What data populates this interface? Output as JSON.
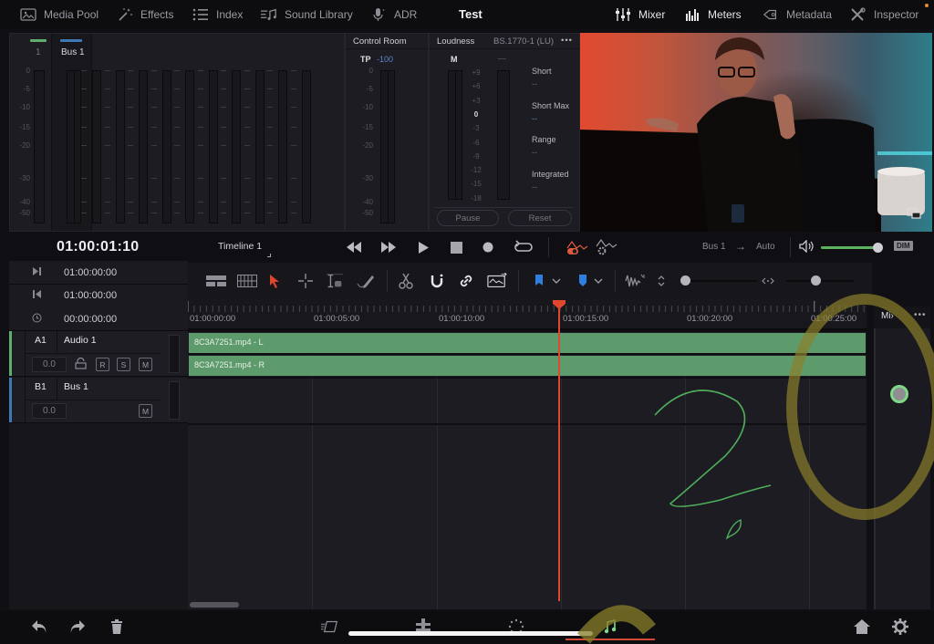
{
  "topbar": {
    "items_left": [
      {
        "icon": "media-pool-icon",
        "label": "Media Pool"
      },
      {
        "icon": "effects-icon",
        "label": "Effects"
      },
      {
        "icon": "index-icon",
        "label": "Index"
      },
      {
        "icon": "sound-library-icon",
        "label": "Sound Library"
      },
      {
        "icon": "adr-icon",
        "label": "ADR"
      }
    ],
    "title": "Test",
    "items_right": [
      {
        "icon": "mixer-icon",
        "label": "Mixer",
        "active": true
      },
      {
        "icon": "meters-icon",
        "label": "Meters",
        "active": true
      },
      {
        "icon": "metadata-icon",
        "label": "Metadata",
        "active": false
      },
      {
        "icon": "inspector-icon",
        "label": "Inspector",
        "active": false
      }
    ]
  },
  "mixer": {
    "channels": [
      {
        "label": "1",
        "color": "#5fae6e"
      },
      {
        "label": "Bus 1",
        "color": "#3f79b5"
      }
    ],
    "scale": [
      "0",
      "-5",
      "-10",
      "-15",
      "-20",
      "-30",
      "-40",
      "-50"
    ]
  },
  "control_room": {
    "title": "Control Room",
    "tp_label": "TP",
    "tp_value": "-100",
    "scale": [
      "0",
      "-5",
      "-10",
      "-15",
      "-20",
      "-30",
      "-40",
      "-50"
    ]
  },
  "loudness": {
    "title": "Loudness",
    "standard": "BS.1770-1 (LU)",
    "more": "•••",
    "m_label": "M",
    "second_label": "---",
    "scale": [
      "+9",
      "+6",
      "+3",
      "0",
      "-3",
      "-6",
      "-9",
      "-12",
      "-15",
      "-18"
    ],
    "stats": [
      {
        "label": "Short",
        "value": "--"
      },
      {
        "label": "Short Max",
        "value": "--"
      },
      {
        "label": "Range",
        "value": "--"
      },
      {
        "label": "Integrated",
        "value": "--"
      }
    ],
    "pause_label": "Pause",
    "reset_label": "Reset"
  },
  "viewer": {
    "pip_icon": "picture-in-picture-icon"
  },
  "transport": {
    "timecode": "01:00:01:10",
    "timeline_name": "Timeline 1",
    "routing_from": "Bus 1",
    "routing_arrow": "→",
    "routing_to": "Auto",
    "dim_label": "DIM",
    "volume": 0.92
  },
  "timecodes": [
    {
      "icon": "out-point-icon",
      "value": "01:00:00:00"
    },
    {
      "icon": "in-point-icon",
      "value": "01:00:00:00"
    },
    {
      "icon": "duration-clock-icon",
      "value": "00:00:00:00"
    }
  ],
  "tracks": [
    {
      "id": "A1",
      "name": "Audio 1",
      "volume": "0.0",
      "color": "#5fae6e",
      "buttons": [
        "R",
        "S",
        "M"
      ]
    },
    {
      "id": "B1",
      "name": "Bus 1",
      "volume": "0.0",
      "color": "#3f79b5",
      "buttons": [
        "M"
      ]
    }
  ],
  "ruler": [
    "01:00:00:00",
    "01:00:05:00",
    "01:00:10:00",
    "01:00:15:00",
    "01:00:20:00",
    "01:00:25:00"
  ],
  "clips": [
    {
      "name": "8C3A7251.mp4 - L"
    },
    {
      "name": "8C3A7251.mp4 - R"
    }
  ],
  "mini_mixer": {
    "label": "Mi›",
    "more": "•••"
  },
  "colors": {
    "accent_green": "#5e9b6c",
    "playhead": "#e0472e",
    "bus_blue": "#3f79b5",
    "annotation_green": "#4fae5b",
    "annotation_yellow": "#8a7f2a"
  }
}
